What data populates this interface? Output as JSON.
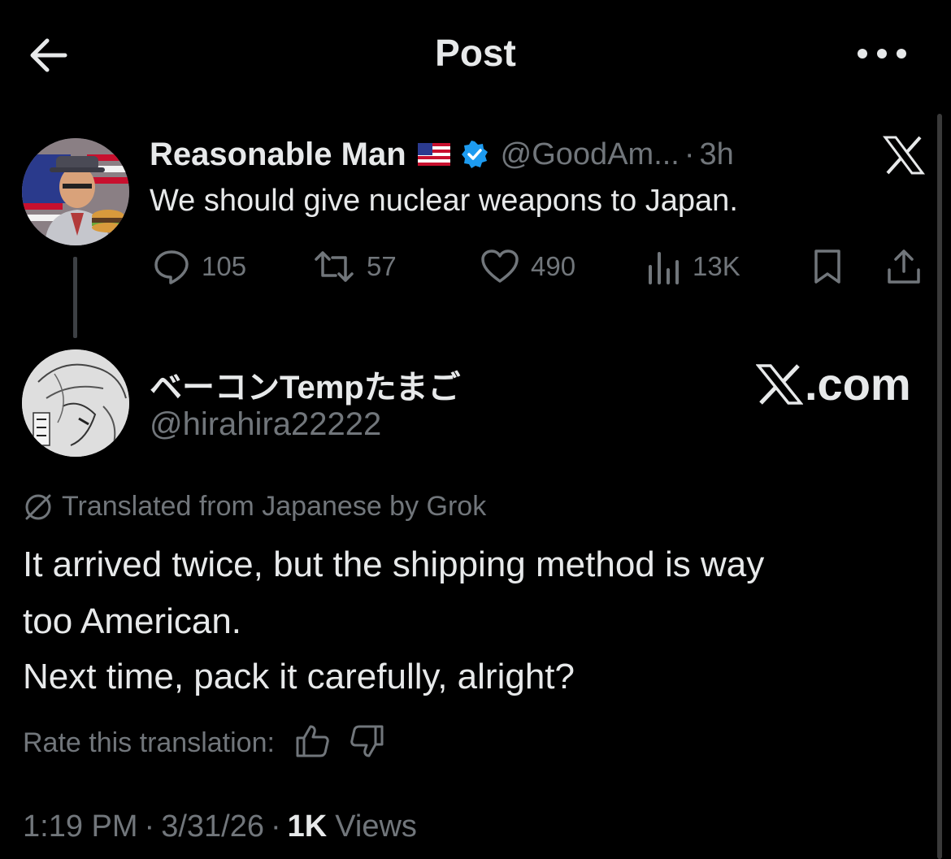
{
  "header": {
    "title": "Post",
    "back_icon": "arrow-left-icon",
    "more_icon": "ellipsis-icon"
  },
  "quoted_post": {
    "author_name": "Reasonable Man",
    "flag": "🇺🇸",
    "handle": "@GoodAm...",
    "dot": "·",
    "time": "3h",
    "text": "We should give nuclear weapons to Japan.",
    "replies": "105",
    "reposts": "57",
    "likes": "490",
    "views": "13K"
  },
  "main_post": {
    "author_name": "ベーコンTempたまご",
    "handle": "@hirahira22222",
    "watermark": ".com",
    "translated_note": "Translated from Japanese by Grok",
    "body_lines": [
      "It arrived twice, but the shipping method is way",
      "too American.",
      "Next time, pack it carefully, alright?"
    ],
    "rate_label": "Rate this translation:",
    "time": "1:19 PM",
    "date": "3/31/26",
    "sep": "·",
    "views_count": "1K",
    "views_label": "Views"
  },
  "colors": {
    "background": "#000000",
    "text": "#e7e9ea",
    "muted": "#71767b",
    "verified": "#1d9bf0"
  }
}
